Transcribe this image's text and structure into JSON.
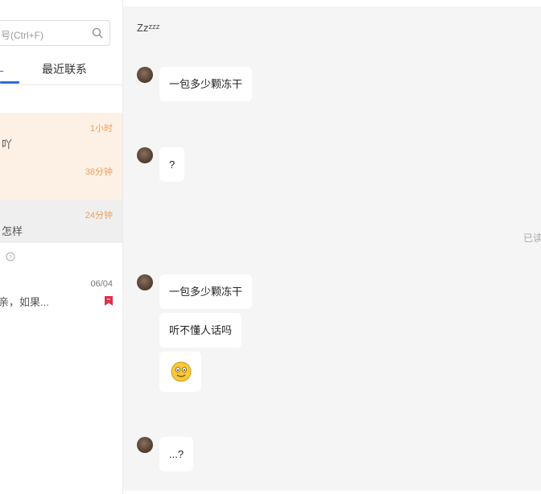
{
  "search": {
    "placeholder": "号(Ctrl+F)"
  },
  "tabs": {
    "partial_label": "L",
    "recent_label": "最近联系"
  },
  "conversations": [
    {
      "time": "1小时",
      "preview": "吖"
    },
    {
      "time": "38分钟",
      "preview": ""
    },
    {
      "time": "24分钟",
      "preview": "怎样"
    },
    {
      "time": "06/04",
      "preview": "亲，如果..."
    }
  ],
  "chat": {
    "status": "Zzᶻᶻᶻ",
    "read_mark": "已读",
    "messages": [
      {
        "text": "一包多少颗冻干"
      },
      {
        "text": "?"
      },
      {
        "text": "一包多少颗冻干"
      },
      {
        "text": "听不懂人话吗"
      },
      {
        "emoji": "smile-emoji"
      },
      {
        "text": "...?"
      }
    ]
  },
  "colors": {
    "accent": "#2f6cd6",
    "time_orange": "#f0a05a",
    "active_bg": "#fdf0e4",
    "selected_bg": "#efefef",
    "bookmark": "#e0314b"
  }
}
